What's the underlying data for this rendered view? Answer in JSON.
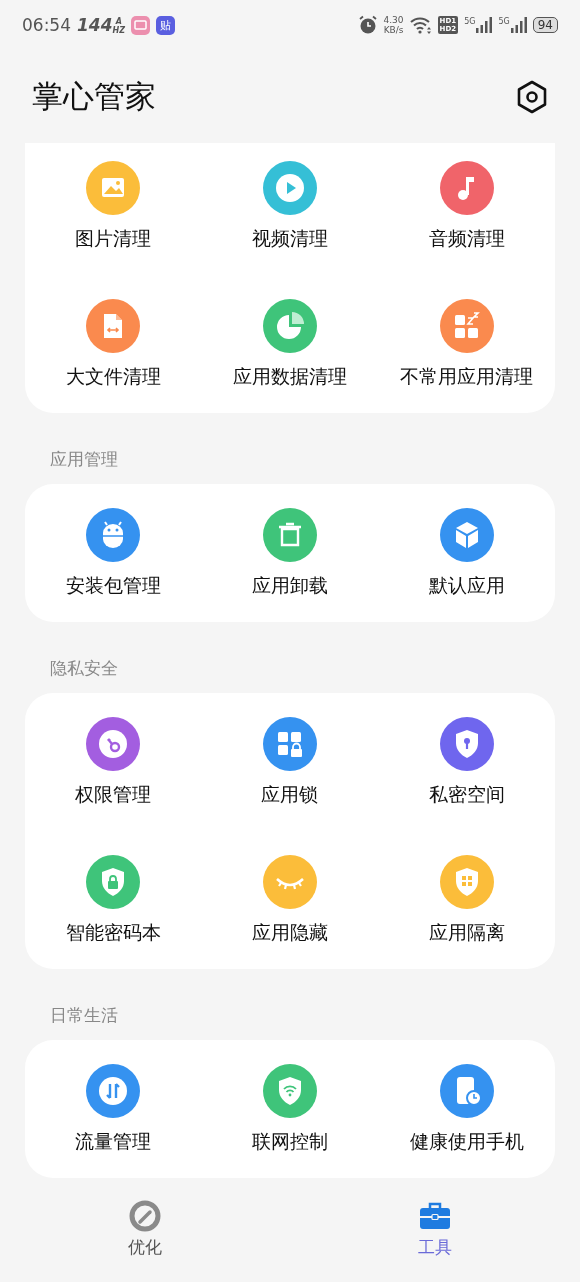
{
  "status_bar": {
    "time": "06:54",
    "refresh_rate": "144",
    "refresh_unit": "HZ",
    "refresh_badge": "A",
    "app_badge": "贴",
    "speed": "4.30",
    "speed_unit": "KB/s",
    "hd1": "HD1",
    "hd2": "HD2",
    "network_1": "5G",
    "network_2": "5G",
    "battery": "94"
  },
  "header": {
    "title": "掌心管家"
  },
  "sections": [
    {
      "items": [
        {
          "label": "图片清理",
          "kind": "image",
          "color": "#fbbd3a"
        },
        {
          "label": "视频清理",
          "kind": "play",
          "color": "#35bfd6"
        },
        {
          "label": "音频清理",
          "kind": "music",
          "color": "#f0646a"
        },
        {
          "label": "大文件清理",
          "kind": "file",
          "color": "#fa8a4e"
        },
        {
          "label": "应用数据清理",
          "kind": "pie",
          "color": "#3fc47a"
        },
        {
          "label": "不常用应用清理",
          "kind": "sleep",
          "color": "#fa8a4e"
        }
      ]
    },
    {
      "title": "应用管理",
      "items": [
        {
          "label": "安装包管理",
          "kind": "android",
          "color": "#3592f0"
        },
        {
          "label": "应用卸载",
          "kind": "trash",
          "color": "#3fc47a"
        },
        {
          "label": "默认应用",
          "kind": "cube",
          "color": "#3592f0"
        }
      ]
    },
    {
      "title": "隐私安全",
      "items": [
        {
          "label": "权限管理",
          "kind": "key",
          "color": "#a35ee0"
        },
        {
          "label": "应用锁",
          "kind": "gridlock",
          "color": "#3592f0"
        },
        {
          "label": "私密空间",
          "kind": "shieldkey",
          "color": "#6f66ee"
        },
        {
          "label": "智能密码本",
          "kind": "shieldlock",
          "color": "#3fc47a"
        },
        {
          "label": "应用隐藏",
          "kind": "eye",
          "color": "#fbbd3a"
        },
        {
          "label": "应用隔离",
          "kind": "shieldgrid",
          "color": "#fbbd3a"
        }
      ]
    },
    {
      "title": "日常生活",
      "items": [
        {
          "label": "流量管理",
          "kind": "arrows",
          "color": "#3592f0"
        },
        {
          "label": "联网控制",
          "kind": "shieldwifi",
          "color": "#3fc47a"
        },
        {
          "label": "健康使用手机",
          "kind": "phoneclock",
          "color": "#3592f0"
        }
      ]
    }
  ],
  "tabs": [
    {
      "label": "优化",
      "kind": "gauge",
      "selected": false
    },
    {
      "label": "工具",
      "kind": "toolbox",
      "selected": true
    }
  ]
}
